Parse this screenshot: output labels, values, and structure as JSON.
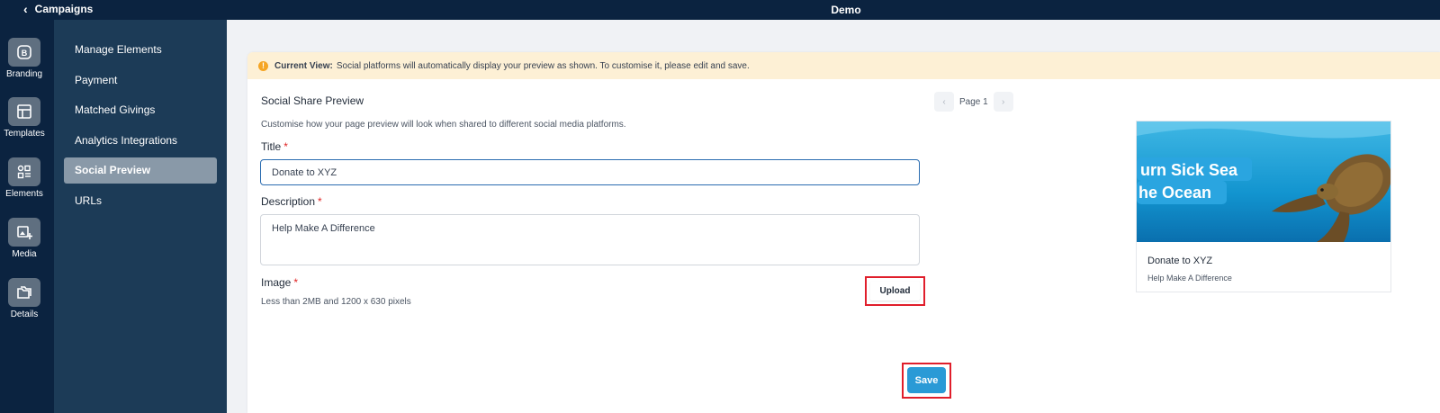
{
  "header": {
    "back_label": "Campaigns",
    "title": "Demo"
  },
  "rail": {
    "items": [
      {
        "label": "Branding",
        "icon": "branding-icon"
      },
      {
        "label": "Templates",
        "icon": "templates-icon"
      },
      {
        "label": "Elements",
        "icon": "elements-icon"
      },
      {
        "label": "Media",
        "icon": "media-icon"
      },
      {
        "label": "Details",
        "icon": "details-icon"
      }
    ]
  },
  "subnav": {
    "items": [
      {
        "label": "Manage Elements",
        "active": false
      },
      {
        "label": "Payment",
        "active": false
      },
      {
        "label": "Matched Givings",
        "active": false
      },
      {
        "label": "Analytics Integrations",
        "active": false
      },
      {
        "label": "Social Preview",
        "active": true
      },
      {
        "label": "URLs",
        "active": false
      }
    ]
  },
  "banner": {
    "strong": "Current View:",
    "text": "Social platforms will automatically display your preview as shown. To customise it, please edit and save.",
    "icon": "warning-icon",
    "color": "#fdf0d5"
  },
  "form": {
    "section_title": "Social Share Preview",
    "section_subtitle": "Customise how your page preview will look when shared to different social media platforms.",
    "title_label": "Title",
    "title_value": "Donate to XYZ",
    "description_label": "Description",
    "description_value": "Help Make A Difference",
    "image_label": "Image",
    "image_hint": "Less than 2MB and 1200 x 630 pixels",
    "upload_label": "Upload",
    "save_label": "Save",
    "required_mark": "*"
  },
  "pager": {
    "label": "Page 1",
    "prev_icon": "chevron-left-icon",
    "next_icon": "chevron-right-icon"
  },
  "preview": {
    "image_text_line1": "urn Sick Sea",
    "image_text_line2": "he Ocean",
    "title": "Donate to XYZ",
    "description": "Help Make A Difference"
  },
  "colors": {
    "topbar": "#0b2340",
    "subnav": "#1c3b57",
    "accent": "#2a9ad6",
    "highlight": "#e01e2b"
  }
}
